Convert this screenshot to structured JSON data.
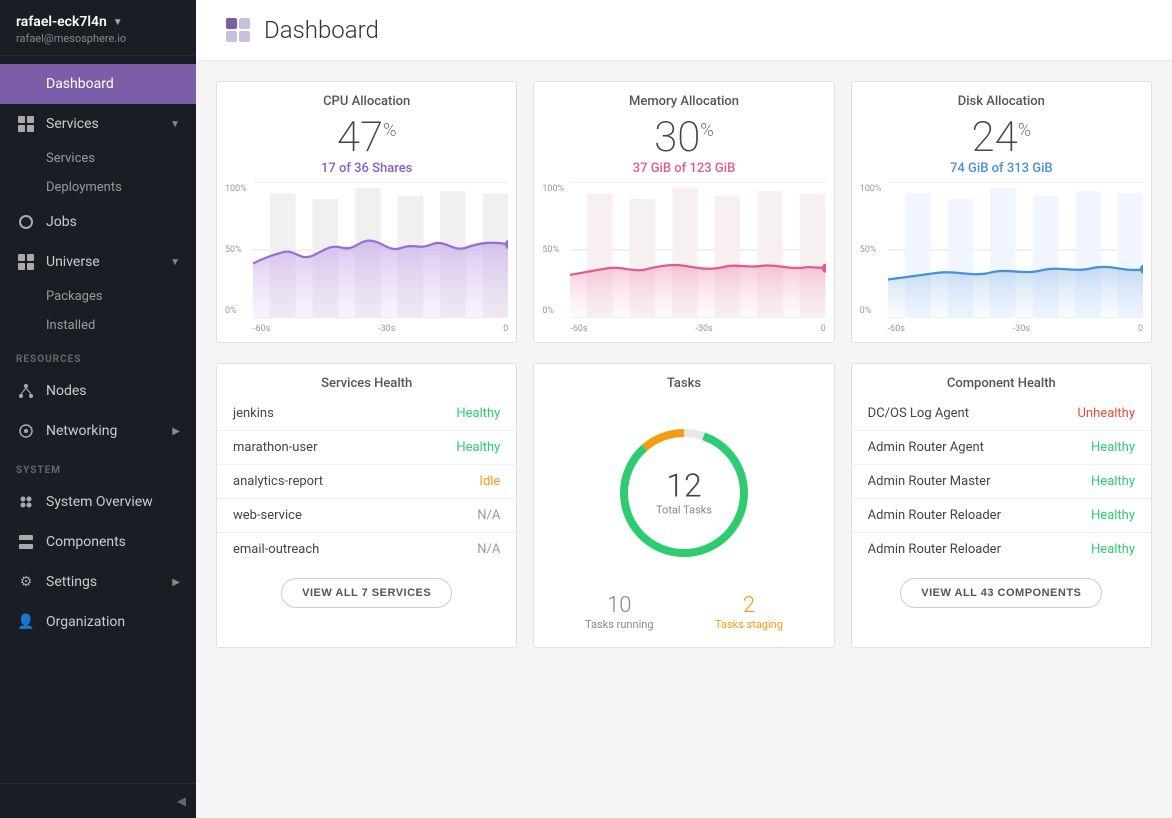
{
  "sidebar": {
    "username": "rafael-eck7l4n",
    "email": "rafael@mesosphere.io",
    "nav": [
      {
        "id": "dashboard",
        "label": "Dashboard",
        "active": true,
        "hasChildren": false
      },
      {
        "id": "services",
        "label": "Services",
        "active": false,
        "hasChildren": true
      },
      {
        "id": "services-sub",
        "label": "Services",
        "sub": true
      },
      {
        "id": "deployments-sub",
        "label": "Deployments",
        "sub": true
      },
      {
        "id": "jobs",
        "label": "Jobs",
        "active": false,
        "hasChildren": false
      },
      {
        "id": "universe",
        "label": "Universe",
        "active": false,
        "hasChildren": true
      },
      {
        "id": "packages-sub",
        "label": "Packages",
        "sub": true
      },
      {
        "id": "installed-sub",
        "label": "Installed",
        "sub": true
      }
    ],
    "resources_section": "RESOURCES",
    "resources_nav": [
      {
        "id": "nodes",
        "label": "Nodes"
      },
      {
        "id": "networking",
        "label": "Networking",
        "hasChildren": true
      }
    ],
    "system_section": "SYSTEM",
    "system_nav": [
      {
        "id": "system-overview",
        "label": "System Overview"
      },
      {
        "id": "components",
        "label": "Components"
      },
      {
        "id": "settings",
        "label": "Settings",
        "hasChildren": true
      },
      {
        "id": "organization",
        "label": "Organization"
      }
    ]
  },
  "page": {
    "title": "Dashboard"
  },
  "cpu": {
    "title": "CPU Allocation",
    "value": "47",
    "unit": "%",
    "sub": "17 of 36 Shares",
    "y_labels": [
      "100%",
      "50%",
      "0%"
    ],
    "x_labels": [
      "-60s",
      "-30s",
      "0"
    ]
  },
  "memory": {
    "title": "Memory Allocation",
    "value": "30",
    "unit": "%",
    "sub": "37 GiB of 123 GiB",
    "y_labels": [
      "100%",
      "50%",
      "0%"
    ],
    "x_labels": [
      "-60s",
      "-30s",
      "0"
    ]
  },
  "disk": {
    "title": "Disk Allocation",
    "value": "24",
    "unit": "%",
    "sub": "74 GiB of 313 GiB",
    "y_labels": [
      "100%",
      "50%",
      "0%"
    ],
    "x_labels": [
      "-60s",
      "-30s",
      "0"
    ]
  },
  "services_health": {
    "title": "Services Health",
    "items": [
      {
        "name": "jenkins",
        "status": "Healthy",
        "statusClass": "healthy"
      },
      {
        "name": "marathon-user",
        "status": "Healthy",
        "statusClass": "healthy"
      },
      {
        "name": "analytics-report",
        "status": "Idle",
        "statusClass": "idle"
      },
      {
        "name": "web-service",
        "status": "N/A",
        "statusClass": "na"
      },
      {
        "name": "email-outreach",
        "status": "N/A",
        "statusClass": "na"
      }
    ],
    "view_all_label": "VIEW ALL 7 SERVICES"
  },
  "tasks": {
    "title": "Tasks",
    "total": "12",
    "total_label": "Total Tasks",
    "running": "10",
    "running_label": "Tasks running",
    "staging": "2",
    "staging_label": "Tasks staging"
  },
  "component_health": {
    "title": "Component Health",
    "items": [
      {
        "name": "DC/OS Log Agent",
        "status": "Unhealthy",
        "statusClass": "unhealthy"
      },
      {
        "name": "Admin Router Agent",
        "status": "Healthy",
        "statusClass": "healthy"
      },
      {
        "name": "Admin Router Master",
        "status": "Healthy",
        "statusClass": "healthy"
      },
      {
        "name": "Admin Router Reloader",
        "status": "Healthy",
        "statusClass": "healthy"
      },
      {
        "name": "Admin Router Reloader",
        "status": "Healthy",
        "statusClass": "healthy"
      }
    ],
    "view_all_label": "VIEW ALL 43 COMPONENTS"
  }
}
